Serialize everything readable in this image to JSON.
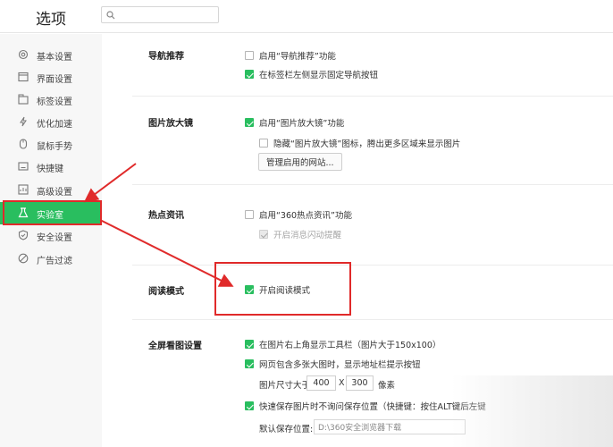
{
  "window": {
    "title": "选项"
  },
  "search": {
    "placeholder": "",
    "value": ""
  },
  "sidebar": {
    "items": [
      {
        "label": "基本设置",
        "icon": "gear-icon",
        "active": false
      },
      {
        "label": "界面设置",
        "icon": "window-icon",
        "active": false
      },
      {
        "label": "标签设置",
        "icon": "tab-icon",
        "active": false
      },
      {
        "label": "优化加速",
        "icon": "lightning-icon",
        "active": false
      },
      {
        "label": "鼠标手势",
        "icon": "mouse-icon",
        "active": false
      },
      {
        "label": "快捷键",
        "icon": "keyboard-icon",
        "active": false
      },
      {
        "label": "高级设置",
        "icon": "advanced-icon",
        "active": false
      },
      {
        "label": "实验室",
        "icon": "flask-icon",
        "active": true
      },
      {
        "label": "安全设置",
        "icon": "shield-icon",
        "active": false
      },
      {
        "label": "广告过滤",
        "icon": "block-icon",
        "active": false
      }
    ]
  },
  "sections": {
    "nav": {
      "title": "导航推荐",
      "opt1": {
        "label": "启用“导航推荐”功能",
        "checked": false
      },
      "opt2": {
        "label": "在标签栏左侧显示固定导航按钮",
        "checked": true
      }
    },
    "zoom": {
      "title": "图片放大镜",
      "opt1": {
        "label": "启用“图片放大镜”功能",
        "checked": true
      },
      "opt2": {
        "label": "隐藏“图片放大镜”图标，腾出更多区域来显示图片",
        "checked": false
      },
      "manage_button": "管理启用的网站..."
    },
    "hot": {
      "title": "热点资讯",
      "opt1": {
        "label": "启用“360热点资讯”功能",
        "checked": false
      },
      "opt2": {
        "label": "开启消息闪动提醒",
        "checked": true,
        "disabled": true
      }
    },
    "reading": {
      "title": "阅读模式",
      "opt1": {
        "label": "开启阅读模式",
        "checked": true
      }
    },
    "fullscreen": {
      "title": "全屏看图设置",
      "opt1": {
        "label": "在图片右上角显示工具栏（图片大于150x100）",
        "checked": true
      },
      "opt2": {
        "label": "网页包含多张大图时，显示地址栏提示按钮",
        "checked": true
      },
      "size_label": "图片尺寸大于",
      "width": "400",
      "times": "X",
      "height": "300",
      "unit": "像素",
      "opt3": {
        "label": "快速保存图片时不询问保存位置（快捷键：按住ALT键后左键",
        "checked": true
      },
      "save_label": "默认保存位置:",
      "save_path": "D:\\360安全浏览器下载"
    }
  },
  "colors": {
    "accent": "#29be5f",
    "highlight": "#e02a2a"
  }
}
